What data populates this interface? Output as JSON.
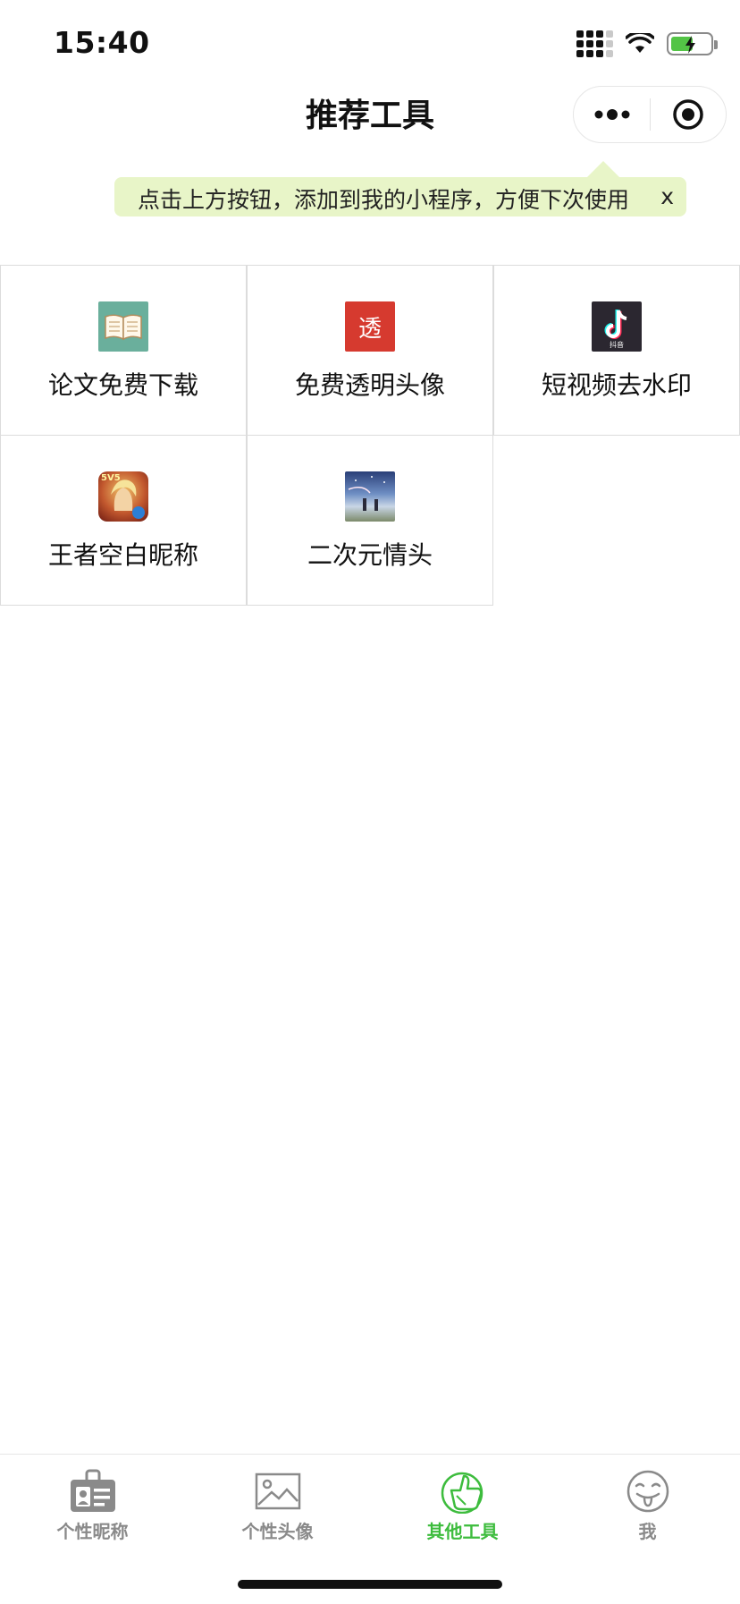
{
  "status": {
    "time": "15:40"
  },
  "nav": {
    "title": "推荐工具"
  },
  "tip": {
    "text": "点击上方按钮，添加到我的小程序，方便下次使用",
    "close": "x"
  },
  "tools": [
    {
      "label": "论文免费下载",
      "icon": "open-book-icon",
      "color": "#6aaf9c"
    },
    {
      "label": "免费透明头像",
      "icon": "tou-character-icon",
      "color": "#d63a2f",
      "glyph": "透"
    },
    {
      "label": "短视频去水印",
      "icon": "douyin-icon",
      "color": "#2b2730",
      "caption": "抖音"
    },
    {
      "label": "王者空白昵称",
      "icon": "honor-of-kings-icon",
      "color": "#8f2a1c",
      "badge": "5V5"
    },
    {
      "label": "二次元情头",
      "icon": "anime-scene-icon",
      "color": "#3d5f9a"
    }
  ],
  "tabbar": [
    {
      "label": "个性昵称",
      "icon": "id-card-icon",
      "active": false
    },
    {
      "label": "个性头像",
      "icon": "image-icon",
      "active": false
    },
    {
      "label": "其他工具",
      "icon": "thumbs-up-icon",
      "active": true
    },
    {
      "label": "我",
      "icon": "tongue-face-icon",
      "active": false
    }
  ]
}
